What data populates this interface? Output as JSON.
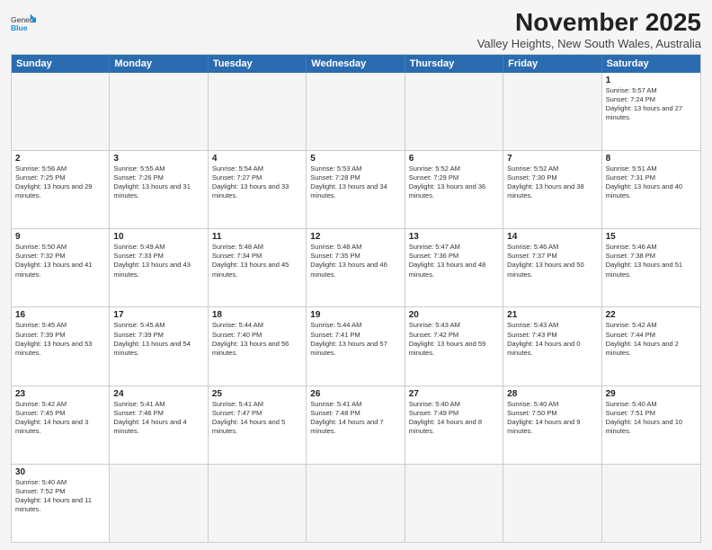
{
  "header": {
    "logo": {
      "general": "General",
      "blue": "Blue"
    },
    "title": "November 2025",
    "subtitle": "Valley Heights, New South Wales, Australia"
  },
  "days": [
    "Sunday",
    "Monday",
    "Tuesday",
    "Wednesday",
    "Thursday",
    "Friday",
    "Saturday"
  ],
  "weeks": [
    [
      {
        "day": "",
        "empty": true
      },
      {
        "day": "",
        "empty": true
      },
      {
        "day": "",
        "empty": true
      },
      {
        "day": "",
        "empty": true
      },
      {
        "day": "",
        "empty": true
      },
      {
        "day": "",
        "empty": true
      },
      {
        "day": "1",
        "sunrise": "Sunrise: 5:57 AM",
        "sunset": "Sunset: 7:24 PM",
        "daylight": "Daylight: 13 hours and 27 minutes."
      }
    ],
    [
      {
        "day": "2",
        "sunrise": "Sunrise: 5:56 AM",
        "sunset": "Sunset: 7:25 PM",
        "daylight": "Daylight: 13 hours and 29 minutes."
      },
      {
        "day": "3",
        "sunrise": "Sunrise: 5:55 AM",
        "sunset": "Sunset: 7:26 PM",
        "daylight": "Daylight: 13 hours and 31 minutes."
      },
      {
        "day": "4",
        "sunrise": "Sunrise: 5:54 AM",
        "sunset": "Sunset: 7:27 PM",
        "daylight": "Daylight: 13 hours and 33 minutes."
      },
      {
        "day": "5",
        "sunrise": "Sunrise: 5:53 AM",
        "sunset": "Sunset: 7:28 PM",
        "daylight": "Daylight: 13 hours and 34 minutes."
      },
      {
        "day": "6",
        "sunrise": "Sunrise: 5:52 AM",
        "sunset": "Sunset: 7:29 PM",
        "daylight": "Daylight: 13 hours and 36 minutes."
      },
      {
        "day": "7",
        "sunrise": "Sunrise: 5:52 AM",
        "sunset": "Sunset: 7:30 PM",
        "daylight": "Daylight: 13 hours and 38 minutes."
      },
      {
        "day": "8",
        "sunrise": "Sunrise: 5:51 AM",
        "sunset": "Sunset: 7:31 PM",
        "daylight": "Daylight: 13 hours and 40 minutes."
      }
    ],
    [
      {
        "day": "9",
        "sunrise": "Sunrise: 5:50 AM",
        "sunset": "Sunset: 7:32 PM",
        "daylight": "Daylight: 13 hours and 41 minutes."
      },
      {
        "day": "10",
        "sunrise": "Sunrise: 5:49 AM",
        "sunset": "Sunset: 7:33 PM",
        "daylight": "Daylight: 13 hours and 43 minutes."
      },
      {
        "day": "11",
        "sunrise": "Sunrise: 5:48 AM",
        "sunset": "Sunset: 7:34 PM",
        "daylight": "Daylight: 13 hours and 45 minutes."
      },
      {
        "day": "12",
        "sunrise": "Sunrise: 5:48 AM",
        "sunset": "Sunset: 7:35 PM",
        "daylight": "Daylight: 13 hours and 46 minutes."
      },
      {
        "day": "13",
        "sunrise": "Sunrise: 5:47 AM",
        "sunset": "Sunset: 7:36 PM",
        "daylight": "Daylight: 13 hours and 48 minutes."
      },
      {
        "day": "14",
        "sunrise": "Sunrise: 5:46 AM",
        "sunset": "Sunset: 7:37 PM",
        "daylight": "Daylight: 13 hours and 50 minutes."
      },
      {
        "day": "15",
        "sunrise": "Sunrise: 5:46 AM",
        "sunset": "Sunset: 7:38 PM",
        "daylight": "Daylight: 13 hours and 51 minutes."
      }
    ],
    [
      {
        "day": "16",
        "sunrise": "Sunrise: 5:45 AM",
        "sunset": "Sunset: 7:39 PM",
        "daylight": "Daylight: 13 hours and 53 minutes."
      },
      {
        "day": "17",
        "sunrise": "Sunrise: 5:45 AM",
        "sunset": "Sunset: 7:39 PM",
        "daylight": "Daylight: 13 hours and 54 minutes."
      },
      {
        "day": "18",
        "sunrise": "Sunrise: 5:44 AM",
        "sunset": "Sunset: 7:40 PM",
        "daylight": "Daylight: 13 hours and 56 minutes."
      },
      {
        "day": "19",
        "sunrise": "Sunrise: 5:44 AM",
        "sunset": "Sunset: 7:41 PM",
        "daylight": "Daylight: 13 hours and 57 minutes."
      },
      {
        "day": "20",
        "sunrise": "Sunrise: 5:43 AM",
        "sunset": "Sunset: 7:42 PM",
        "daylight": "Daylight: 13 hours and 59 minutes."
      },
      {
        "day": "21",
        "sunrise": "Sunrise: 5:43 AM",
        "sunset": "Sunset: 7:43 PM",
        "daylight": "Daylight: 14 hours and 0 minutes."
      },
      {
        "day": "22",
        "sunrise": "Sunrise: 5:42 AM",
        "sunset": "Sunset: 7:44 PM",
        "daylight": "Daylight: 14 hours and 2 minutes."
      }
    ],
    [
      {
        "day": "23",
        "sunrise": "Sunrise: 5:42 AM",
        "sunset": "Sunset: 7:45 PM",
        "daylight": "Daylight: 14 hours and 3 minutes."
      },
      {
        "day": "24",
        "sunrise": "Sunrise: 5:41 AM",
        "sunset": "Sunset: 7:46 PM",
        "daylight": "Daylight: 14 hours and 4 minutes."
      },
      {
        "day": "25",
        "sunrise": "Sunrise: 5:41 AM",
        "sunset": "Sunset: 7:47 PM",
        "daylight": "Daylight: 14 hours and 5 minutes."
      },
      {
        "day": "26",
        "sunrise": "Sunrise: 5:41 AM",
        "sunset": "Sunset: 7:48 PM",
        "daylight": "Daylight: 14 hours and 7 minutes."
      },
      {
        "day": "27",
        "sunrise": "Sunrise: 5:40 AM",
        "sunset": "Sunset: 7:49 PM",
        "daylight": "Daylight: 14 hours and 8 minutes."
      },
      {
        "day": "28",
        "sunrise": "Sunrise: 5:40 AM",
        "sunset": "Sunset: 7:50 PM",
        "daylight": "Daylight: 14 hours and 9 minutes."
      },
      {
        "day": "29",
        "sunrise": "Sunrise: 5:40 AM",
        "sunset": "Sunset: 7:51 PM",
        "daylight": "Daylight: 14 hours and 10 minutes."
      }
    ],
    [
      {
        "day": "30",
        "sunrise": "Sunrise: 5:40 AM",
        "sunset": "Sunset: 7:52 PM",
        "daylight": "Daylight: 14 hours and 11 minutes."
      },
      {
        "day": "",
        "empty": true
      },
      {
        "day": "",
        "empty": true
      },
      {
        "day": "",
        "empty": true
      },
      {
        "day": "",
        "empty": true
      },
      {
        "day": "",
        "empty": true
      },
      {
        "day": "",
        "empty": true
      }
    ]
  ]
}
